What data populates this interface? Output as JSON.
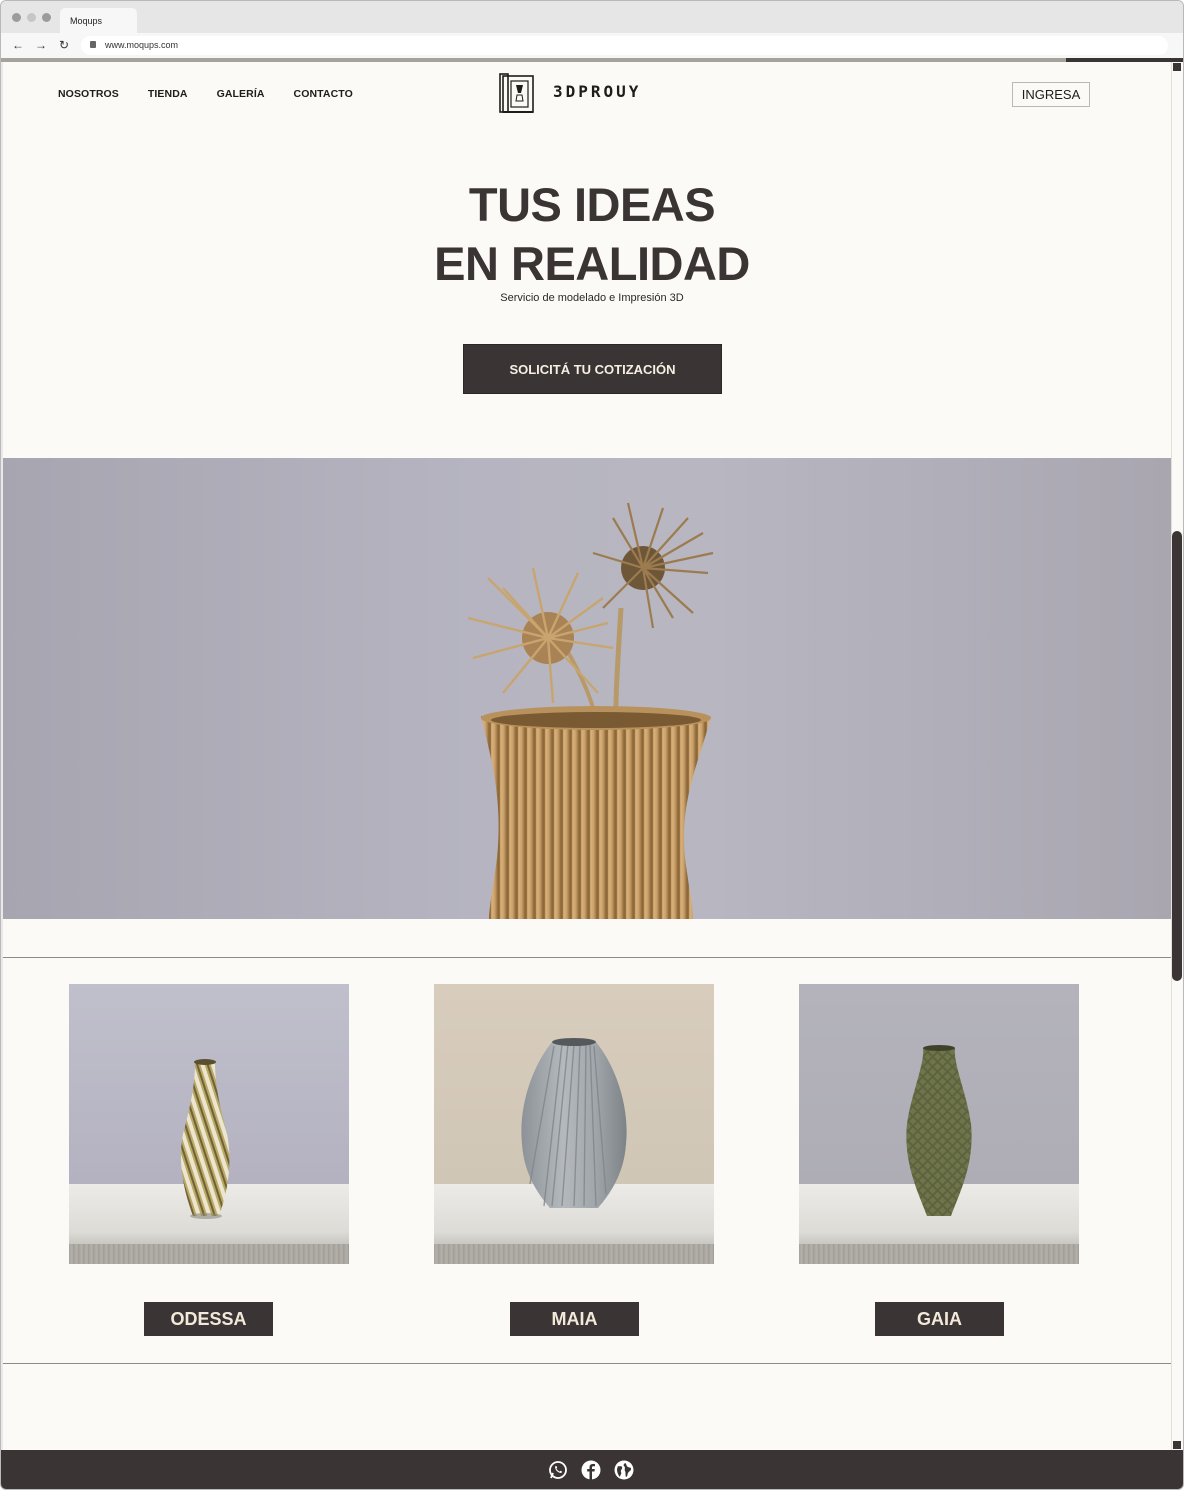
{
  "browser": {
    "tab_title": "Moqups",
    "url": "www.moqups.com"
  },
  "nav": {
    "items": [
      "NOSOTROS",
      "TIENDA",
      "GALERÍA",
      "CONTACTO"
    ],
    "brand": "3DPROUY",
    "login_label": "INGRESA"
  },
  "hero": {
    "title_line1": "TUS IDEAS",
    "title_line2": "EN REALIDAD",
    "subtitle": "Servicio de modelado e Impresión 3D",
    "cta_label": "SOLICITÁ TU COTIZACIÓN"
  },
  "products": [
    {
      "name": "ODESSA"
    },
    {
      "name": "MAIA"
    },
    {
      "name": "GAIA"
    }
  ],
  "footer": {
    "icons": [
      "whatsapp-icon",
      "facebook-icon",
      "globe-icon"
    ]
  },
  "colors": {
    "dark": "#3a3534",
    "page_bg": "#fcfaf6",
    "button_text": "#f7efe2"
  }
}
